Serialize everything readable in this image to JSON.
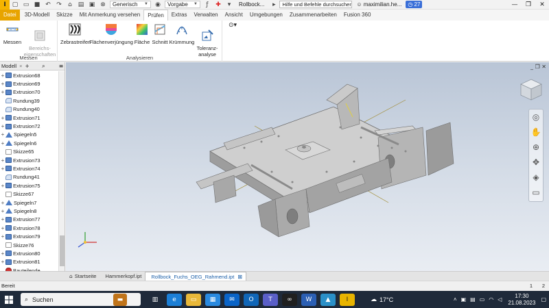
{
  "qat": {
    "logo": "I",
    "material_combo": "Generisch",
    "appearance_combo": "Vorgabe",
    "doc_title": "Rollbock...",
    "search_placeholder": "Hilfe und Befehle durchsuchen...",
    "user": "maximilian.he...",
    "badge": "27"
  },
  "tabs": [
    {
      "label": "Datei",
      "kind": "file"
    },
    {
      "label": "3D-Modell",
      "kind": ""
    },
    {
      "label": "Skizze",
      "kind": ""
    },
    {
      "label": "Mit Anmerkung versehen",
      "kind": ""
    },
    {
      "label": "Prüfen",
      "kind": "active"
    },
    {
      "label": "Extras",
      "kind": ""
    },
    {
      "label": "Verwalten",
      "kind": ""
    },
    {
      "label": "Ansicht",
      "kind": ""
    },
    {
      "label": "Umgebungen",
      "kind": ""
    },
    {
      "label": "Zusammenarbeiten",
      "kind": ""
    },
    {
      "label": "Fusion 360",
      "kind": ""
    }
  ],
  "ribbon": {
    "messen_panel": {
      "name": "Messen",
      "buttons": [
        {
          "label": "Messen",
          "icon": "ruler-icon"
        },
        {
          "label": "Bereichs-\neigenschaften",
          "icon": "region-properties-icon"
        }
      ]
    },
    "analysieren_panel": {
      "name": "Analysieren",
      "buttons": [
        {
          "label": "Zebrastreifen",
          "icon": "zebra-icon"
        },
        {
          "label": "Flächenverjüngung",
          "icon": "draft-icon"
        },
        {
          "label": "Fläche",
          "icon": "surface-icon"
        },
        {
          "label": "Schnitt",
          "icon": "section-icon"
        },
        {
          "label": "Krümmung",
          "icon": "curvature-icon"
        },
        {
          "label": "Toleranz-\nanalyse",
          "icon": "tolerance-icon"
        }
      ]
    }
  },
  "browser": {
    "title": "Modell",
    "items": [
      {
        "label": "Extrusion68",
        "type": "ext",
        "expand": true
      },
      {
        "label": "Extrusion69",
        "type": "ext",
        "expand": true
      },
      {
        "label": "Extrusion70",
        "type": "ext",
        "expand": true
      },
      {
        "label": "Rundung39",
        "type": "rnd",
        "expand": false
      },
      {
        "label": "Rundung40",
        "type": "rnd",
        "expand": false
      },
      {
        "label": "Extrusion71",
        "type": "ext",
        "expand": true
      },
      {
        "label": "Extrusion72",
        "type": "ext",
        "expand": true
      },
      {
        "label": "Spiegeln5",
        "type": "mir",
        "expand": true
      },
      {
        "label": "Spiegeln6",
        "type": "mir",
        "expand": true
      },
      {
        "label": "Skizze65",
        "type": "skt",
        "expand": false
      },
      {
        "label": "Extrusion73",
        "type": "ext",
        "expand": true
      },
      {
        "label": "Extrusion74",
        "type": "ext",
        "expand": true
      },
      {
        "label": "Rundung41",
        "type": "rnd",
        "expand": false
      },
      {
        "label": "Extrusion75",
        "type": "ext",
        "expand": true
      },
      {
        "label": "Skizze67",
        "type": "skt",
        "expand": false
      },
      {
        "label": "Spiegeln7",
        "type": "mir",
        "expand": true
      },
      {
        "label": "Spiegeln8",
        "type": "mir",
        "expand": true
      },
      {
        "label": "Extrusion77",
        "type": "ext",
        "expand": true
      },
      {
        "label": "Extrusion78",
        "type": "ext",
        "expand": true
      },
      {
        "label": "Extrusion79",
        "type": "ext",
        "expand": true
      },
      {
        "label": "Skizze76",
        "type": "skt",
        "expand": false
      },
      {
        "label": "Extrusion80",
        "type": "ext",
        "expand": true
      },
      {
        "label": "Extrusion81",
        "type": "ext",
        "expand": true
      },
      {
        "label": "Bauteilende",
        "type": "end",
        "expand": false
      }
    ]
  },
  "doc_tabs": [
    {
      "label": "Startseite",
      "active": false
    },
    {
      "label": "Hammerkopf.ipt",
      "active": false
    },
    {
      "label": "Rollbock_Fuchs_OEG_Rahmend.ipt",
      "active": true
    }
  ],
  "status": {
    "text": "Bereit",
    "num1": "1",
    "num2": "2"
  },
  "taskbar": {
    "search_label": "Suchen",
    "temperature": "17°C",
    "time": "17:30",
    "date": "21.08.2023"
  },
  "colors": {
    "accent": "#e8a400",
    "model_gray": "#c9c9c9",
    "viewport_top": "#b9c5d6"
  }
}
